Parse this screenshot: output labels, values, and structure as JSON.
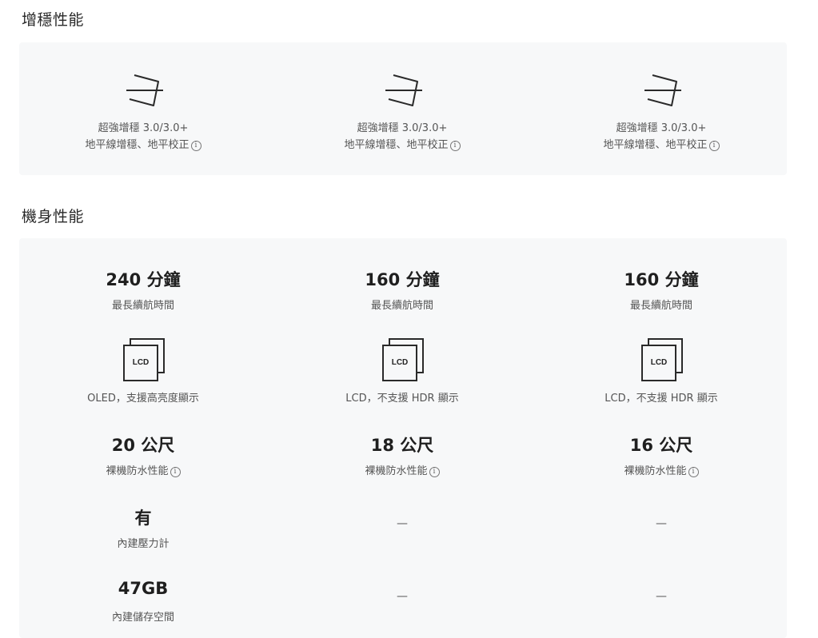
{
  "sections": {
    "stabilization_title": "增穩性能",
    "body_title": "機身性能"
  },
  "stabilization": [
    {
      "line1": "超強增穩 3.0/3.0+",
      "line2": "地平線增穩、地平校正",
      "icon": "stabilization-icon"
    },
    {
      "line1": "超強增穩 3.0/3.0+",
      "line2": "地平線增穩、地平校正",
      "icon": "stabilization-icon"
    },
    {
      "line1": "超強增穩 3.0/3.0+",
      "line2": "地平線增穩、地平校正",
      "icon": "stabilization-icon"
    }
  ],
  "info_glyph": "i",
  "body": [
    {
      "battery_value": "240 分鐘",
      "battery_label": "最長續航時間",
      "screen_icon_text": "LCD",
      "screen_label": "OLED，支援高亮度顯示",
      "waterproof_value": "20 公尺",
      "waterproof_label": "裸機防水性能",
      "pressure_value": "有",
      "pressure_label": "內建壓力計",
      "storage_value": "47GB",
      "storage_label": "內建儲存空間"
    },
    {
      "battery_value": "160 分鐘",
      "battery_label": "最長續航時間",
      "screen_icon_text": "LCD",
      "screen_label": "LCD，不支援 HDR 顯示",
      "waterproof_value": "18 公尺",
      "waterproof_label": "裸機防水性能",
      "pressure_dash": "—",
      "storage_dash": "—"
    },
    {
      "battery_value": "160 分鐘",
      "battery_label": "最長續航時間",
      "screen_icon_text": "LCD",
      "screen_label": "LCD，不支援 HDR 顯示",
      "waterproof_value": "16 公尺",
      "waterproof_label": "裸機防水性能",
      "pressure_dash": "—",
      "storage_dash": "—"
    }
  ]
}
